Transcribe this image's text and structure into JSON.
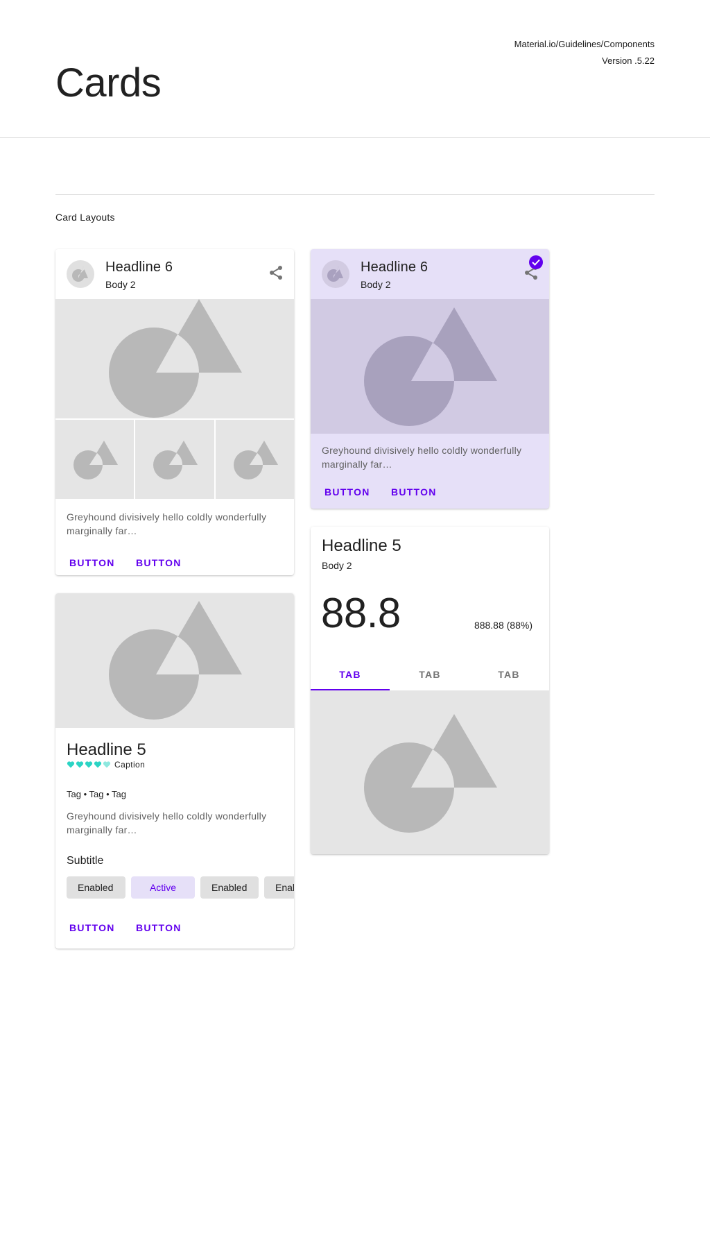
{
  "header": {
    "title": "Cards",
    "meta_line1": "Material.io/Guidelines/Components",
    "meta_line2": "Version .5.22"
  },
  "section": {
    "label": "Card Layouts"
  },
  "colors": {
    "primary": "#6200ee",
    "selected_bg": "#e6e0f8",
    "placeholder_bg": "#e5e5e5",
    "placeholder_shape": "#b8b8b8",
    "rating": "#2bd4c4"
  },
  "card1": {
    "title": "Headline 6",
    "subtitle": "Body 2",
    "body": "Greyhound divisively hello coldly wonderfully marginally far…",
    "button1": "Button",
    "button2": "Button"
  },
  "card2": {
    "title": "Headline 6",
    "subtitle": "Body 2",
    "body": "Greyhound divisively hello coldly wonderfully marginally far…",
    "button1": "Button",
    "button2": "Button",
    "selected": true
  },
  "card3": {
    "title": "Headline 5",
    "subtitle": "Body 2",
    "value": "88.8",
    "delta": "888.88 (88%)",
    "tabs": [
      "Tab",
      "Tab",
      "Tab"
    ],
    "active_tab_index": 0
  },
  "card4": {
    "title": "Headline 5",
    "rating": 4.5,
    "rating_max": 5,
    "caption": "Caption",
    "tags": "Tag • Tag • Tag",
    "body": "Greyhound divisively hello coldly wonderfully marginally far…",
    "subtitle": "Subtitle",
    "chips": [
      "Enabled",
      "Active",
      "Enabled",
      "Enabled"
    ],
    "active_chip_index": 1,
    "button1": "Button",
    "button2": "Button"
  }
}
